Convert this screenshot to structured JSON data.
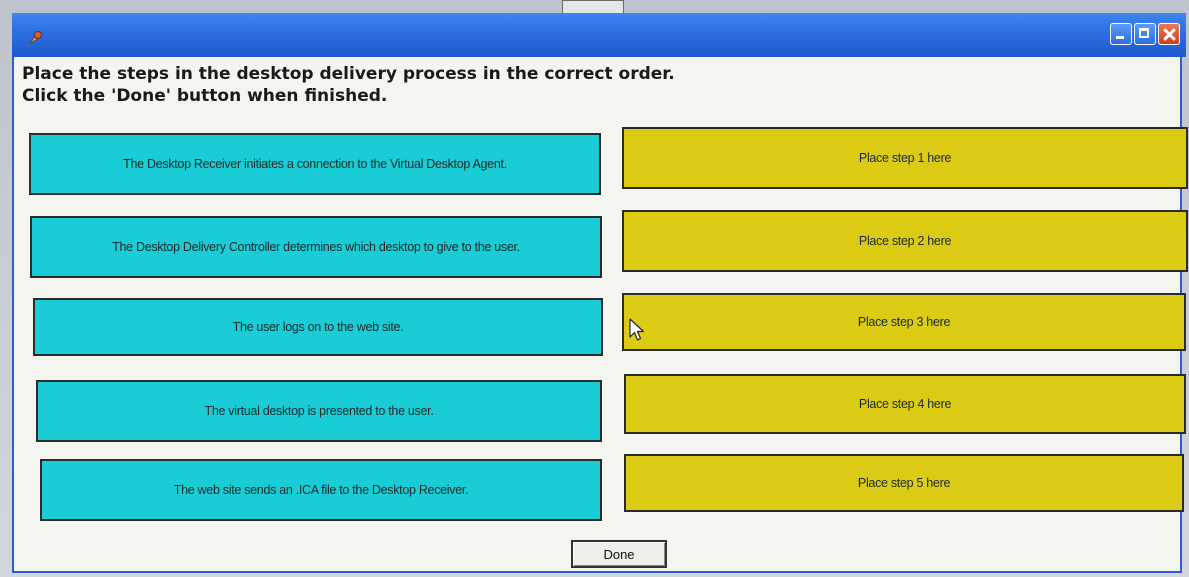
{
  "window": {
    "instruction_line1": "Place the steps in the desktop delivery process in the correct order.",
    "instruction_line2": "Click the 'Done' button when finished."
  },
  "source_steps": [
    "The Desktop Receiver initiates a connection to the Virtual Desktop Agent.",
    "The Desktop Delivery Controller determines which desktop to give to the user.",
    "The user logs on to the web site.",
    "The virtual desktop is presented to the user.",
    "The web site sends an .ICA file to the Desktop Receiver."
  ],
  "target_slots": [
    "Place step 1 here",
    "Place step 2 here",
    "Place step 3 here",
    "Place step 4 here",
    "Place step 5 here"
  ],
  "done_label": "Done",
  "colors": {
    "titlebar": "#2d6fe0",
    "source_box": "#19ccd6",
    "target_box": "#dccb14",
    "window_bg": "#f4f4f1"
  }
}
